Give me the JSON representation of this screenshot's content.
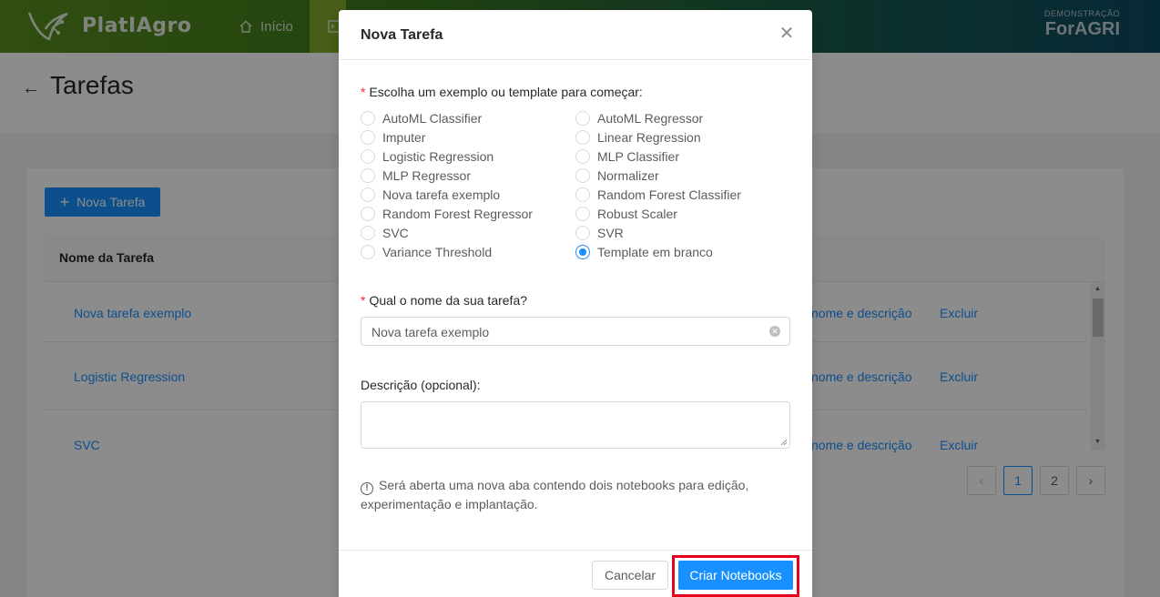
{
  "header": {
    "brand": "PlatIAgro",
    "nav_home": "Início",
    "right_small": "DEMONSTRAÇÃO",
    "right_big": "ForAGRI"
  },
  "page": {
    "title": "Tarefas",
    "new_task_button": "Nova Tarefa",
    "table_header": "Nome da Tarefa",
    "rows": [
      {
        "name": "Nova tarefa exemplo",
        "rename": "nome e descrição",
        "delete": "Excluir"
      },
      {
        "name": "Logistic Regression",
        "rename": "nome e descrição",
        "delete": "Excluir"
      },
      {
        "name": "SVC",
        "rename": "nome e descrição",
        "delete": "Excluir"
      }
    ],
    "pagination": {
      "prev": "‹",
      "pages": [
        "1",
        "2"
      ],
      "next": "›",
      "current": "1"
    }
  },
  "modal": {
    "title": "Nova Tarefa",
    "choose_label": "Escolha um exemplo ou template para começar:",
    "templates_left": [
      "AutoML Classifier",
      "Imputer",
      "Logistic Regression",
      "MLP Regressor",
      "Nova tarefa exemplo",
      "Random Forest Regressor",
      "SVC",
      "Variance Threshold"
    ],
    "templates_right": [
      "AutoML Regressor",
      "Linear Regression",
      "MLP Classifier",
      "Normalizer",
      "Random Forest Classifier",
      "Robust Scaler",
      "SVR",
      "Template em branco"
    ],
    "selected_template": "Template em branco",
    "name_label": "Qual o nome da sua tarefa?",
    "name_value": "Nova tarefa exemplo",
    "description_label": "Descrição (opcional):",
    "description_value": "",
    "info_text": "Será aberta uma nova aba contendo dois notebooks para edição, experimentação e implantação.",
    "cancel_label": "Cancelar",
    "create_label": "Criar Notebooks"
  },
  "colors": {
    "primary": "#1890ff",
    "highlight": "#e8001c",
    "required": "#f5222d"
  }
}
